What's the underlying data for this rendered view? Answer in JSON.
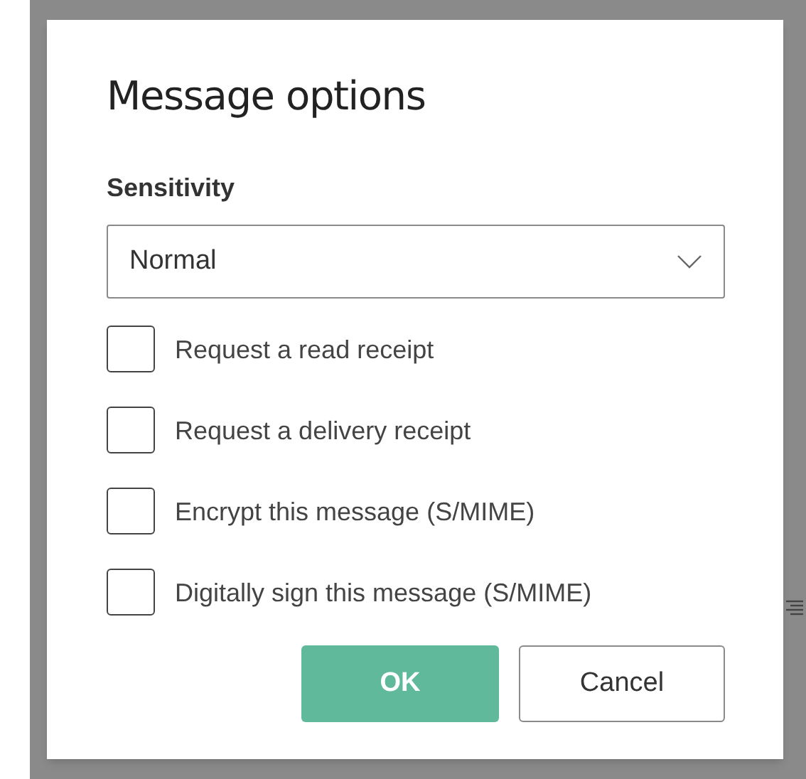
{
  "dialog": {
    "title": "Message options"
  },
  "sensitivity": {
    "label": "Sensitivity",
    "value": "Normal"
  },
  "options": [
    {
      "label": "Request a read receipt",
      "checked": false
    },
    {
      "label": "Request a delivery receipt",
      "checked": false
    },
    {
      "label": "Encrypt this message (S/MIME)",
      "checked": false
    },
    {
      "label": "Digitally sign this message (S/MIME)",
      "checked": false
    }
  ],
  "buttons": [
    {
      "label": "OK",
      "kind": "primary"
    },
    {
      "label": "Cancel",
      "kind": "secondary"
    }
  ]
}
